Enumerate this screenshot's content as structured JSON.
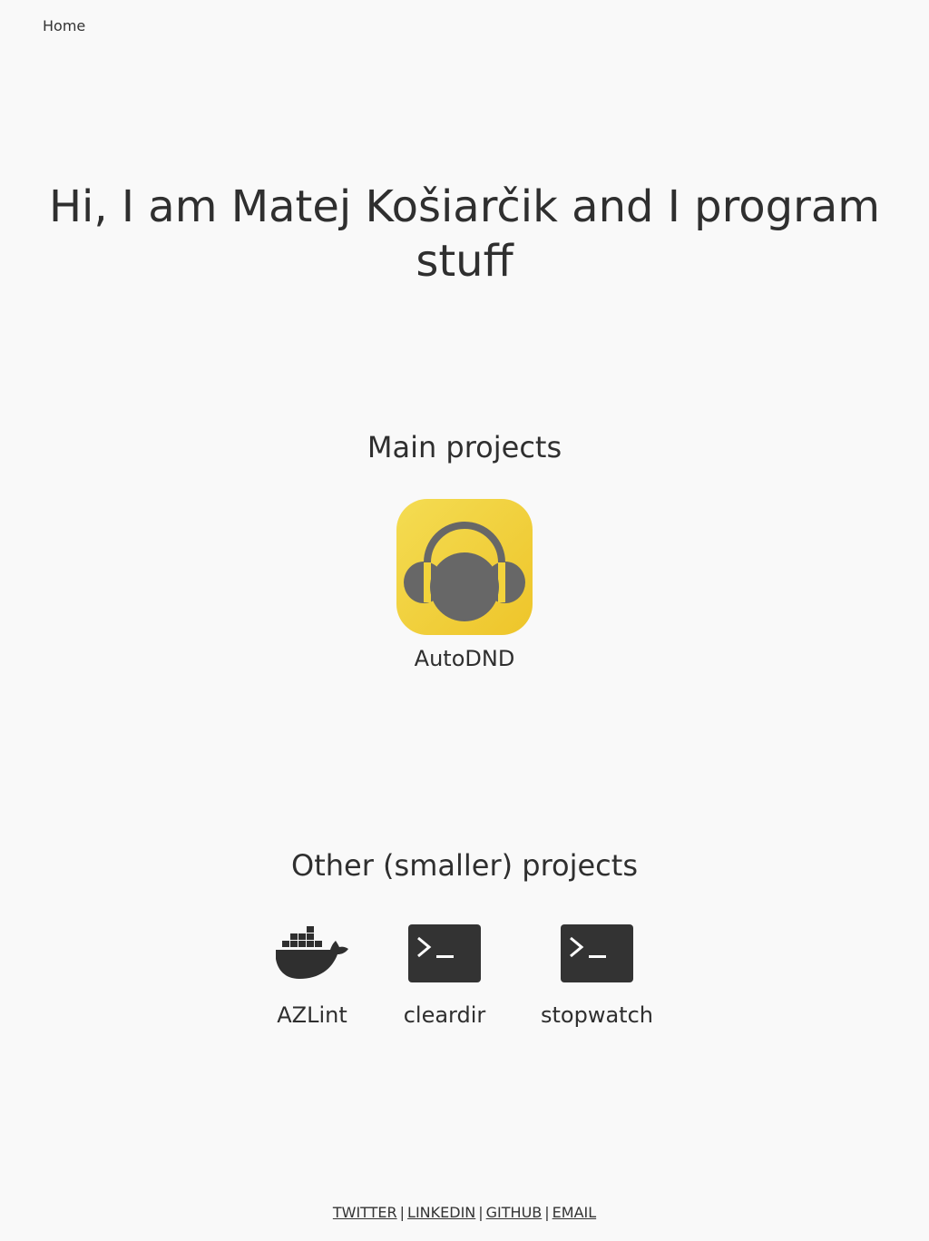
{
  "nav": {
    "home": "Home"
  },
  "hero": {
    "title": "Hi, I am Matej Košiarčik and I program stuff"
  },
  "main_projects": {
    "title": "Main projects",
    "items": [
      {
        "label": "AutoDND",
        "icon": "headphones-icon"
      }
    ]
  },
  "other_projects": {
    "title": "Other (smaller) projects",
    "items": [
      {
        "label": "AZLint",
        "icon": "docker-whale-icon"
      },
      {
        "label": "cleardir",
        "icon": "terminal-icon"
      },
      {
        "label": "stopwatch",
        "icon": "terminal-icon"
      }
    ]
  },
  "footer": {
    "links": [
      "TWITTER",
      "LINKEDIN",
      "GITHUB",
      "EMAIL"
    ],
    "separator": "|"
  },
  "colors": {
    "background": "#f9f9f9",
    "text": "#2f2f2f",
    "autodnd_yellow": "#f2d33c",
    "autodnd_gray": "#666666",
    "terminal_bg": "#333333"
  }
}
